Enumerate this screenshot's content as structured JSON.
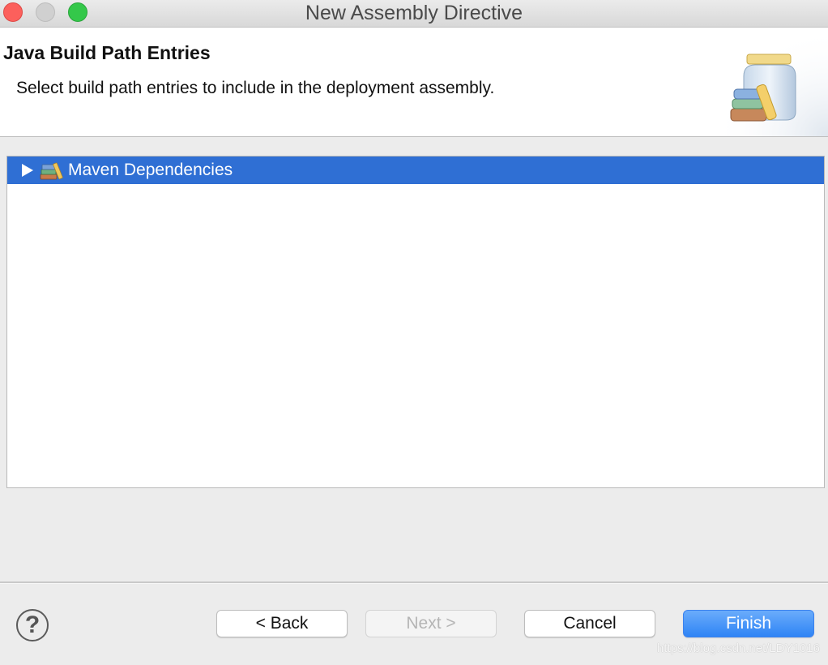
{
  "window": {
    "title": "New Assembly Directive"
  },
  "banner": {
    "title": "Java Build Path Entries",
    "description": "Select build path entries to include in the deployment assembly.",
    "image_icon": "library-jar-icon"
  },
  "tree": {
    "items": [
      {
        "label": "Maven Dependencies",
        "icon": "library-icon",
        "expanded": false,
        "selected": true
      }
    ]
  },
  "buttons": {
    "help": "?",
    "back": "< Back",
    "next": "Next >",
    "cancel": "Cancel",
    "finish": "Finish"
  },
  "colors": {
    "selection": "#2f6fd4",
    "default_button": "#3d8cf7"
  },
  "watermark": "https://blog.csdn.net/LDY1016"
}
